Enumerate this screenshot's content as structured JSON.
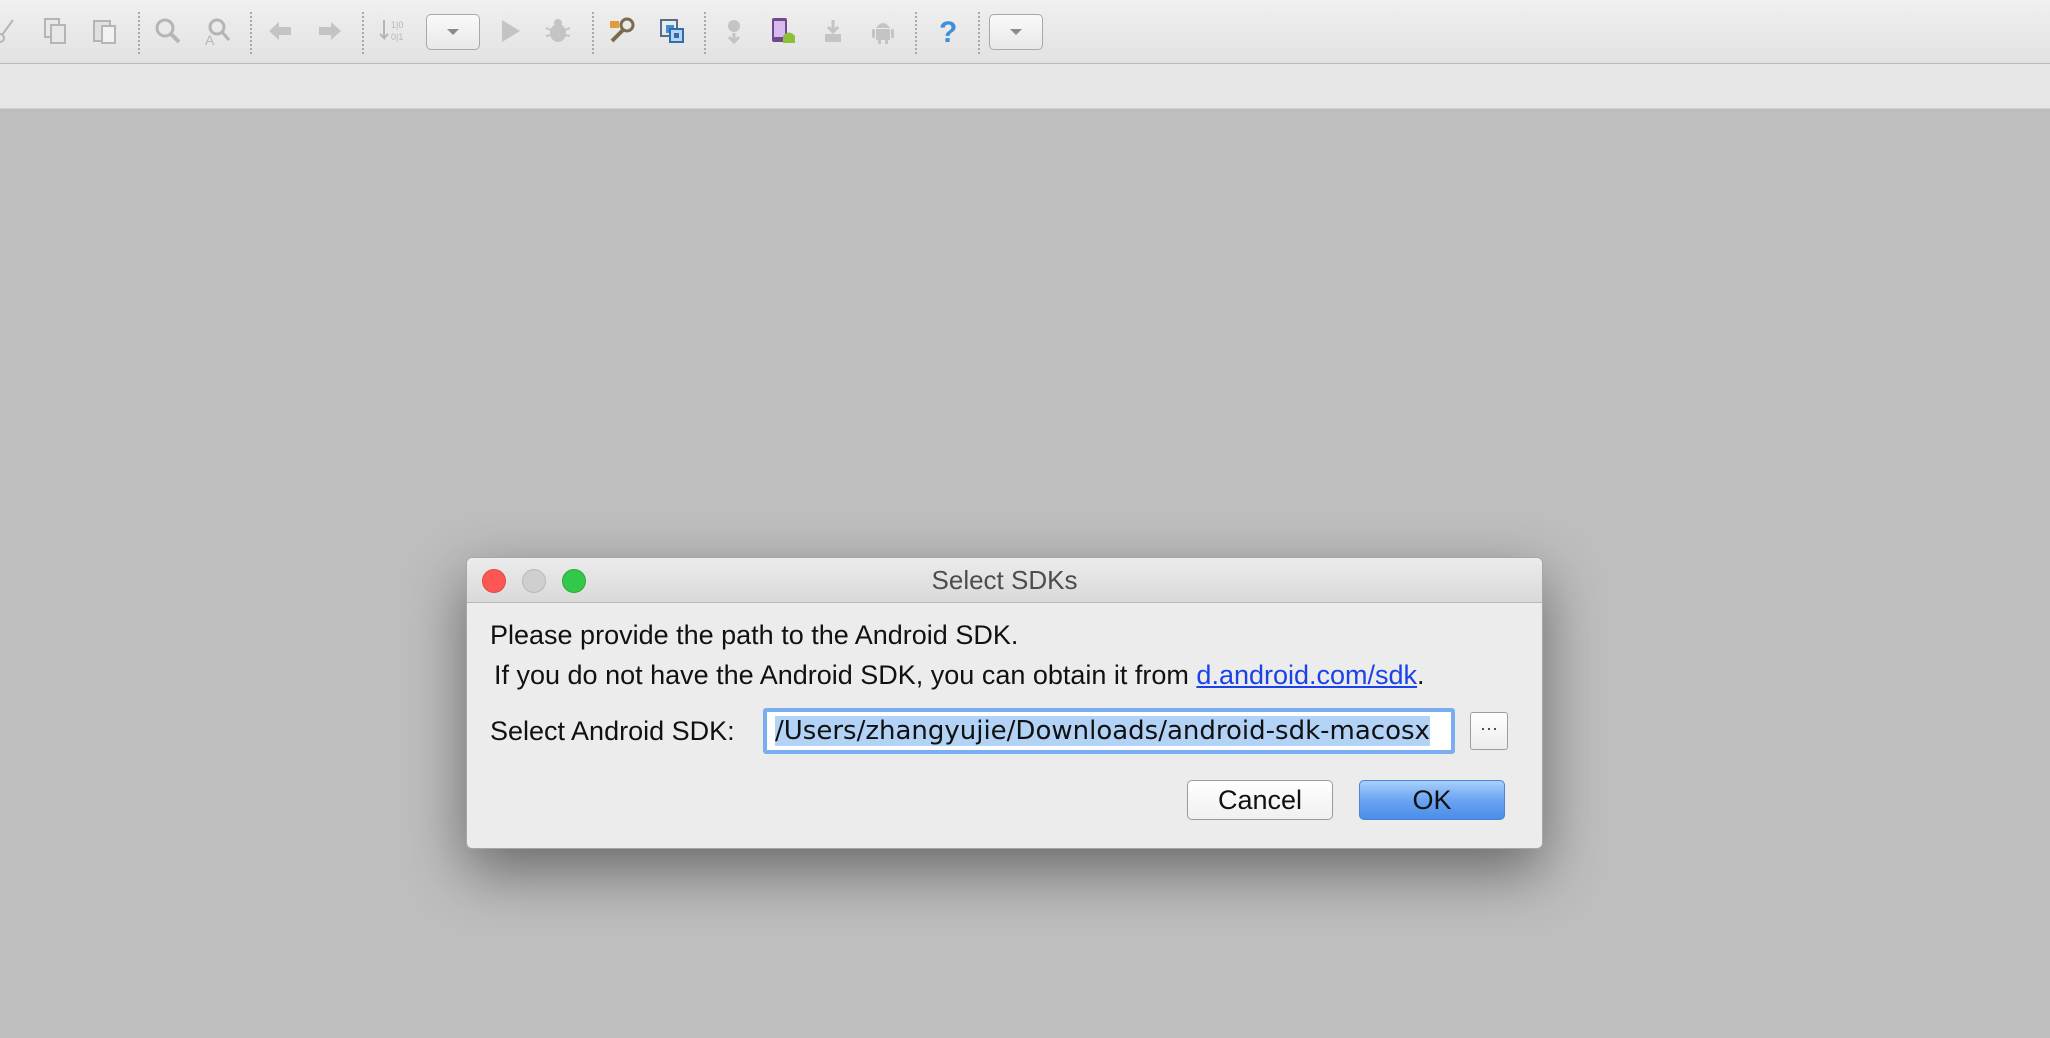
{
  "toolbar": {
    "icons": [
      "cut-icon",
      "copy-icon",
      "paste-icon",
      "find-icon",
      "replace-icon",
      "back-icon",
      "forward-icon",
      "sort-icon",
      "run-config-dropdown",
      "run-icon",
      "debug-icon",
      "project-structure-icon",
      "sdk-manager-icon",
      "sync-icon",
      "avd-manager-icon",
      "download-icon",
      "android-icon",
      "help-icon",
      "more-dropdown"
    ]
  },
  "dialog": {
    "title": "Select SDKs",
    "message_line1": "Please provide the path to the Android SDK.",
    "message_line2_prefix": "If you do not have the Android SDK, you can obtain it from ",
    "message_line2_link": "d.android.com/sdk",
    "message_line2_suffix": ".",
    "sdk_label": "Select Android SDK:",
    "sdk_path": "/Users/zhangyujie/Downloads/android-sdk-macosx",
    "browse_label": "···",
    "cancel_label": "Cancel",
    "ok_label": "OK"
  },
  "colors": {
    "link": "#1a42e8",
    "close": "#fc5753",
    "maximize": "#34c84a",
    "ok_button": "#6aa4f2",
    "focus_ring": "#7aaef0"
  }
}
